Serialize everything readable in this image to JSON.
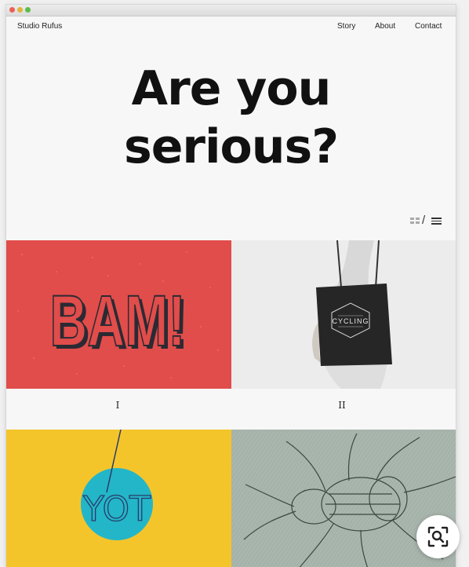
{
  "site": {
    "brand": "Studio Rufus"
  },
  "nav": {
    "items": [
      "Story",
      "About",
      "Contact"
    ]
  },
  "hero": {
    "line1": "Are you",
    "line2": "serious?"
  },
  "view_toggle": {
    "separator": "/"
  },
  "projects": [
    {
      "numeral": "I",
      "artwork_text": "BAM!"
    },
    {
      "numeral": "II",
      "artwork_text": "CYCLING"
    },
    {
      "artwork_text": "YOT"
    },
    {
      "artwork_text": ""
    }
  ],
  "colors": {
    "bam_bg": "#e04d4b",
    "yot_bg": "#f4c52b",
    "yot_circle": "#23b6c8",
    "engraving_bg": "#a6b3aa"
  },
  "icons": {
    "view_grid": "grid-icon",
    "view_list": "list-icon",
    "zoom": "visual-search-icon"
  }
}
